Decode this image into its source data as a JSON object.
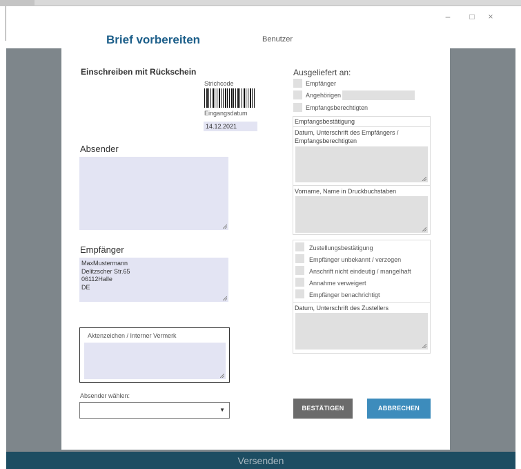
{
  "window": {
    "minimize_glyph": "–",
    "maximize_glyph": "□",
    "close_glyph": "×"
  },
  "app": {
    "title": "Brief vorbereiten",
    "user_label": "Benutzer",
    "footer_button": "Versenden"
  },
  "form": {
    "heading": "Einschreiben mit Rückschein",
    "barcode_label": "Strichcode",
    "date_label": "Eingangsdatum",
    "date_value": "14.12.2021",
    "sender_heading": "Absender",
    "sender_value": "",
    "recipient_heading": "Empfänger",
    "recipient_value": "MaxMustermann\nDelitzscher Str.65\n06112Halle\nDE",
    "reference_label": "Aktenzeichen / Interner Vermerk",
    "reference_value": "",
    "sender_select_label": "Absender wählen:",
    "sender_select_value": ""
  },
  "delivery": {
    "title": "Ausgeliefert an:",
    "options": [
      "Empfänger",
      "Angehörigen",
      "Empfangsberechtigten"
    ],
    "angehoerigen_value": ""
  },
  "receipt": {
    "title": "Empfangsbestätigung",
    "sig_label": "Datum, Unterschrift des Empfängers / Empfangsberechtigten",
    "name_label": "Vorname, Name in Druckbuchstaben"
  },
  "delivery_status": {
    "options": [
      "Zustellungsbestätigung",
      "Empfänger unbekannt / verzogen",
      "Anschrift nicht eindeutig / mangelhaft",
      "Annahme verweigert",
      "Empfänger benachrichtigt"
    ],
    "sig_label": "Datum, Unterschrift des Zustellers"
  },
  "buttons": {
    "confirm": "BESTÄTIGEN",
    "cancel": "ABBRECHEN"
  },
  "colors": {
    "accent": "#1d5f8a",
    "footer": "#1d4d62",
    "cancel_button": "#3d8cbc",
    "confirm_button": "#6b6b6b",
    "field_bg": "#e3e4f3"
  }
}
